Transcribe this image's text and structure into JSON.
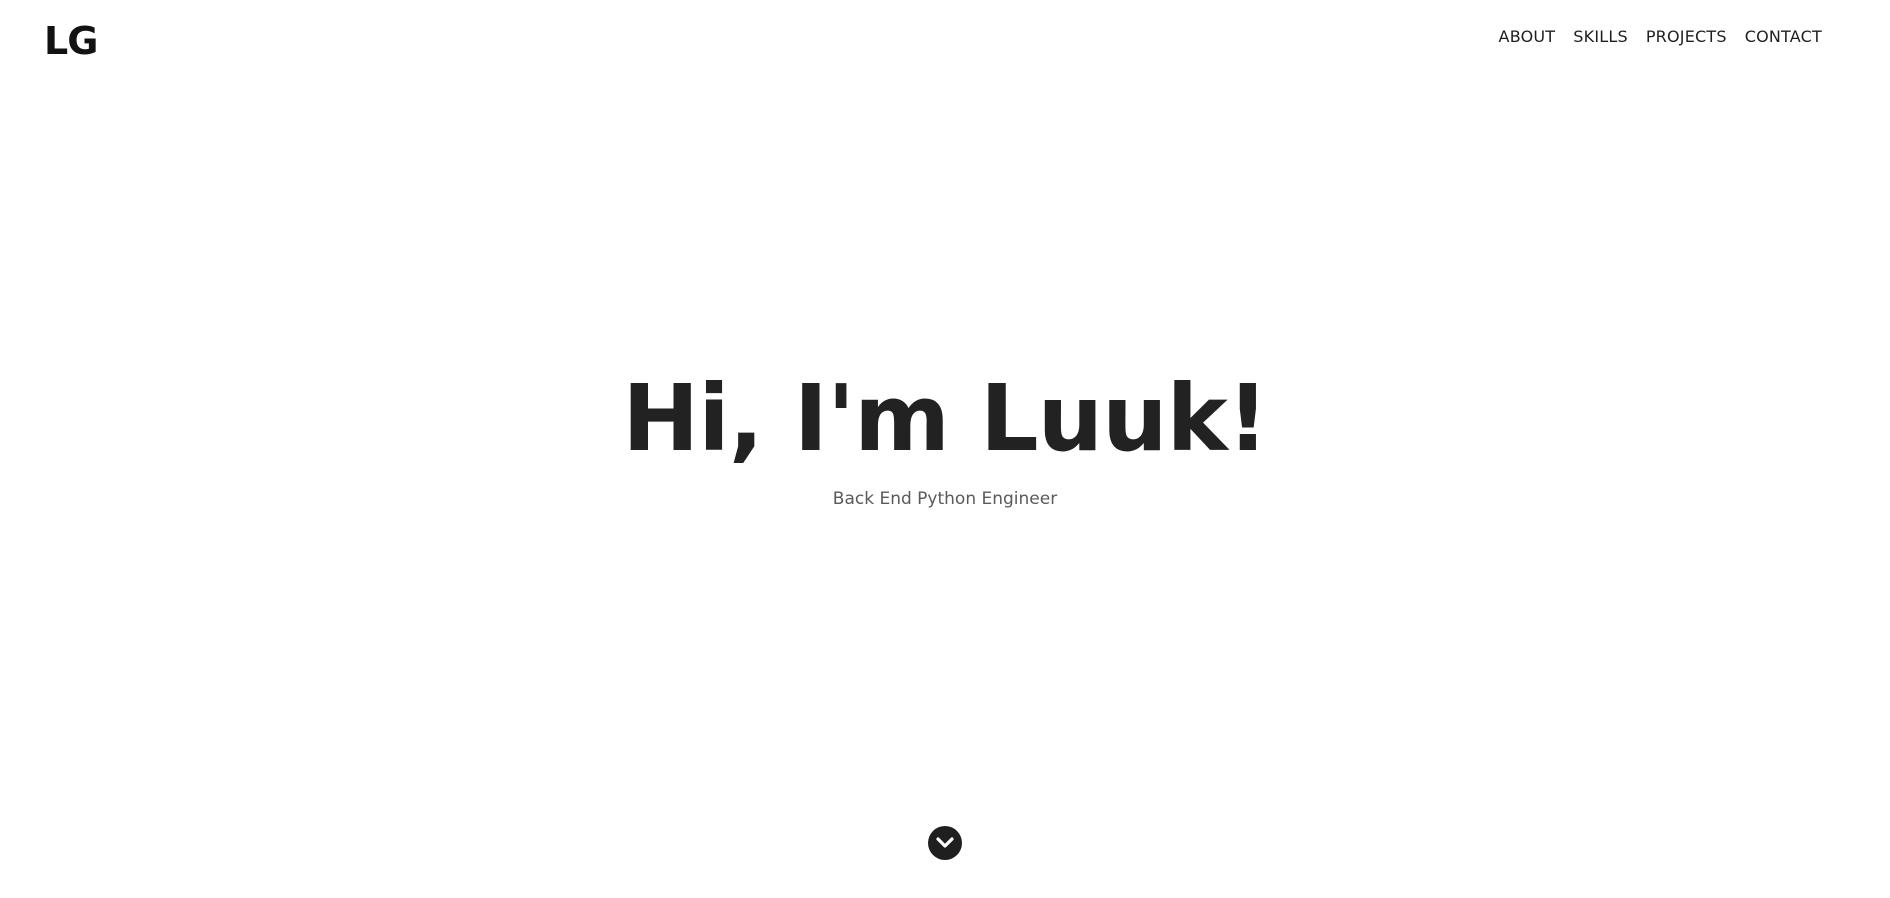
{
  "header": {
    "logo": "LG",
    "nav": [
      {
        "label": "ABOUT"
      },
      {
        "label": "SKILLS"
      },
      {
        "label": "PROJECTS"
      },
      {
        "label": "CONTACT"
      }
    ]
  },
  "hero": {
    "title": "Hi, I'm Luuk!",
    "subtitle": "Back End Python Engineer"
  },
  "scroll_button": {
    "icon": "chevron-down-circle-icon"
  },
  "colors": {
    "background": "#ffffff",
    "text_primary": "#222222",
    "text_secondary": "#5a5a5a",
    "button": "#1f1f1f"
  }
}
